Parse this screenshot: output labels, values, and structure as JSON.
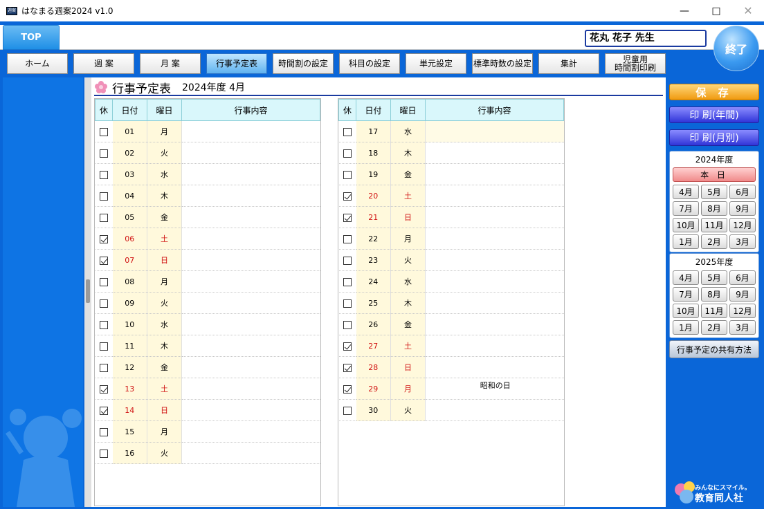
{
  "window": {
    "title": "はなまる週案2024 v1.0",
    "icon_label": "週案"
  },
  "header": {
    "top_tab": "TOP",
    "teacher": "花丸 花子 先生",
    "exit": "終了"
  },
  "nav": [
    "ホーム",
    "週 案",
    "月 案",
    "行事予定表",
    "時間割の設定",
    "科目の設定",
    "単元設定",
    "標準時数の設定",
    "集計",
    "児童用\n時間割印刷"
  ],
  "page": {
    "title": "行事予定表",
    "subtitle": "2024年度 4月"
  },
  "columns": {
    "kyu": "休",
    "day": "日付",
    "weekday": "曜日",
    "event": "行事内容"
  },
  "left_rows": [
    {
      "day": "01",
      "wd": "月",
      "off": false,
      "ev": ""
    },
    {
      "day": "02",
      "wd": "火",
      "off": false,
      "ev": ""
    },
    {
      "day": "03",
      "wd": "水",
      "off": false,
      "ev": ""
    },
    {
      "day": "04",
      "wd": "木",
      "off": false,
      "ev": ""
    },
    {
      "day": "05",
      "wd": "金",
      "off": false,
      "ev": ""
    },
    {
      "day": "06",
      "wd": "土",
      "off": true,
      "ev": ""
    },
    {
      "day": "07",
      "wd": "日",
      "off": true,
      "ev": ""
    },
    {
      "day": "08",
      "wd": "月",
      "off": false,
      "ev": ""
    },
    {
      "day": "09",
      "wd": "火",
      "off": false,
      "ev": ""
    },
    {
      "day": "10",
      "wd": "水",
      "off": false,
      "ev": ""
    },
    {
      "day": "11",
      "wd": "木",
      "off": false,
      "ev": ""
    },
    {
      "day": "12",
      "wd": "金",
      "off": false,
      "ev": ""
    },
    {
      "day": "13",
      "wd": "土",
      "off": true,
      "ev": ""
    },
    {
      "day": "14",
      "wd": "日",
      "off": true,
      "ev": ""
    },
    {
      "day": "15",
      "wd": "月",
      "off": false,
      "ev": ""
    },
    {
      "day": "16",
      "wd": "火",
      "off": false,
      "ev": ""
    }
  ],
  "right_rows": [
    {
      "day": "17",
      "wd": "水",
      "off": false,
      "ev": ""
    },
    {
      "day": "18",
      "wd": "木",
      "off": false,
      "ev": ""
    },
    {
      "day": "19",
      "wd": "金",
      "off": false,
      "ev": ""
    },
    {
      "day": "20",
      "wd": "土",
      "off": true,
      "ev": ""
    },
    {
      "day": "21",
      "wd": "日",
      "off": true,
      "ev": ""
    },
    {
      "day": "22",
      "wd": "月",
      "off": false,
      "ev": ""
    },
    {
      "day": "23",
      "wd": "火",
      "off": false,
      "ev": ""
    },
    {
      "day": "24",
      "wd": "水",
      "off": false,
      "ev": ""
    },
    {
      "day": "25",
      "wd": "木",
      "off": false,
      "ev": ""
    },
    {
      "day": "26",
      "wd": "金",
      "off": false,
      "ev": ""
    },
    {
      "day": "27",
      "wd": "土",
      "off": true,
      "ev": ""
    },
    {
      "day": "28",
      "wd": "日",
      "off": true,
      "ev": ""
    },
    {
      "day": "29",
      "wd": "月",
      "off": true,
      "ev": "昭和の日"
    },
    {
      "day": "30",
      "wd": "火",
      "off": false,
      "ev": ""
    }
  ],
  "sidebar": {
    "save": "保 存",
    "print_year": "印 刷(年間)",
    "print_month": "印 刷(月別)",
    "today": "本 日",
    "years": [
      {
        "label": "2024年度",
        "months": [
          "4月",
          "5月",
          "6月",
          "7月",
          "8月",
          "9月",
          "10月",
          "11月",
          "12月",
          "1月",
          "2月",
          "3月"
        ]
      },
      {
        "label": "2025年度",
        "months": [
          "4月",
          "5月",
          "6月",
          "7月",
          "8月",
          "9月",
          "10月",
          "11月",
          "12月",
          "1月",
          "2月",
          "3月"
        ]
      }
    ],
    "share": "行事予定の共有方法"
  },
  "logo": {
    "tagline": "みんなにスマイル。",
    "name": "教育同人社"
  },
  "colors": {
    "accent_blue": "#0a66d8",
    "weekend_red": "#d01010",
    "save_orange": "#f09a10",
    "print_blue": "#3034d8"
  }
}
